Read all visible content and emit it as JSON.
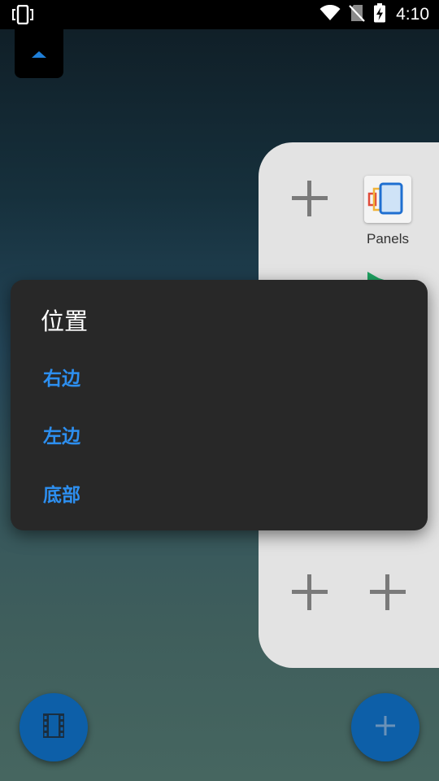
{
  "status_bar": {
    "time": "4:10",
    "icons": [
      "phone-rotate-icon",
      "wifi-icon",
      "no-sim-icon",
      "battery-charging-icon"
    ]
  },
  "top_handle": {
    "icon": "caret-up-icon"
  },
  "panel": {
    "apps": [
      {
        "label": "Panels",
        "icon": "panels-app-icon"
      }
    ],
    "empty_slots_icon": "plus-icon"
  },
  "dialog": {
    "title": "位置",
    "options": [
      {
        "label": "右边"
      },
      {
        "label": "左边"
      },
      {
        "label": "底部"
      }
    ]
  },
  "fabs": {
    "left_icon": "film-icon",
    "right_icon": "plus-icon"
  },
  "colors": {
    "accent": "#2d8ff0",
    "fab": "#0d5fa8",
    "dialog_bg": "#282828",
    "panel_bg": "#e3e3e3"
  }
}
